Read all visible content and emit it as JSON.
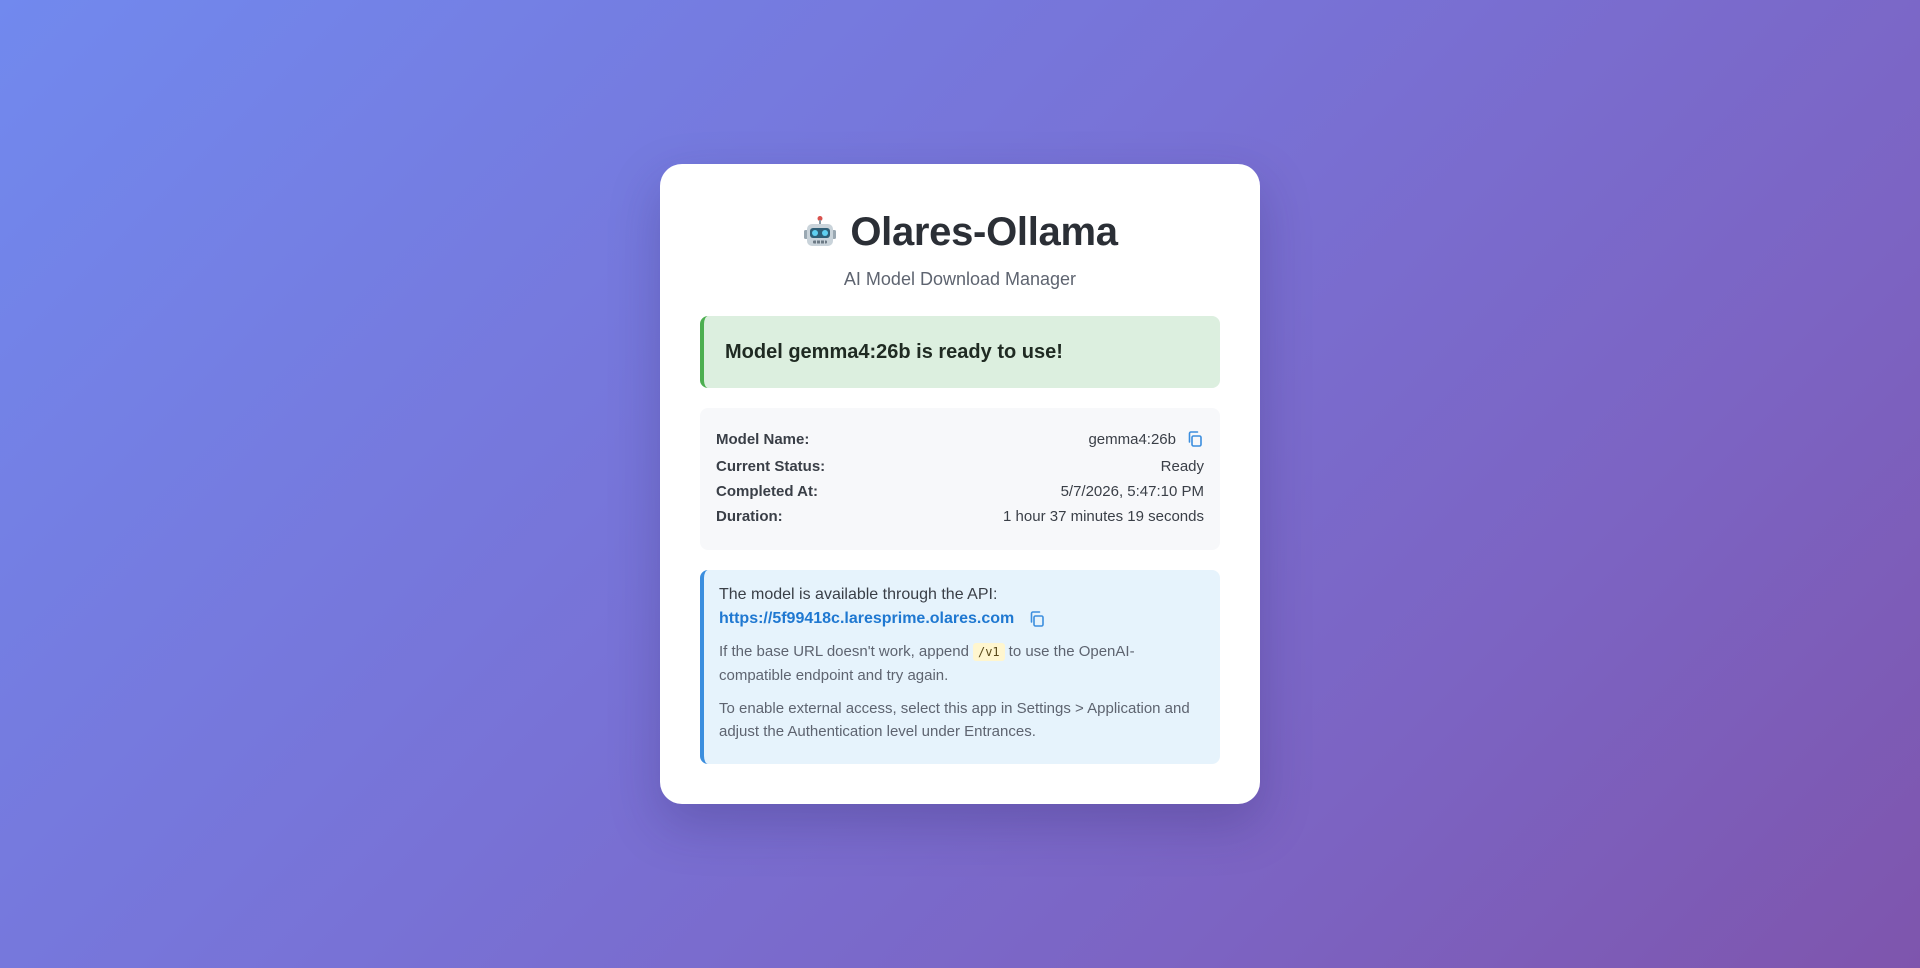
{
  "header": {
    "icon": "robot-icon",
    "title": "Olares-Ollama",
    "subtitle": "AI Model Download Manager"
  },
  "status_banner": {
    "message": "Model gemma4:26b is ready to use!",
    "color": "#4caf50"
  },
  "details": {
    "model_name_label": "Model Name:",
    "model_name_value": "gemma4:26b",
    "status_label": "Current Status:",
    "status_value": "Ready",
    "completed_label": "Completed At:",
    "completed_value": "5/7/2026, 5:47:10 PM",
    "duration_label": "Duration:",
    "duration_value": "1 hour 37 minutes 19 seconds"
  },
  "api": {
    "intro": "The model is available through the API:",
    "url": "https://5f99418c.laresprime.olares.com",
    "note_prefix": "If the base URL doesn't work, append",
    "note_code": "/v1",
    "note_suffix": "to use the OpenAI-compatible endpoint and try again.",
    "access_note": "To enable external access, select this app in Settings > Application and adjust the Authentication level under Entrances."
  },
  "colors": {
    "accent": "#1f78d1",
    "success": "#4caf50",
    "background_start": "#7189ee",
    "background_end": "#7e55ad"
  }
}
